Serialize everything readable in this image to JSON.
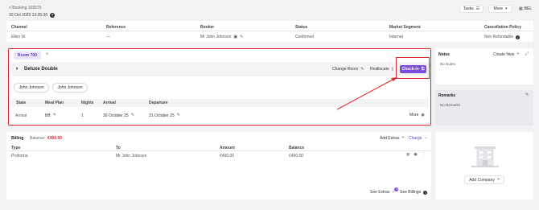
{
  "header": {
    "back_label": "< Booking 105575",
    "datetime": "30 Oct 2025 13:35:36",
    "tasks": "Tasks",
    "more": "More",
    "user": "BEL"
  },
  "booking_table": {
    "headers": [
      "Channel",
      "Reference",
      "Booker",
      "Status",
      "Market Segment",
      "Cancellation Policy"
    ],
    "row": [
      "Ellen W.",
      "—",
      "Mr John Johnson",
      "Confirmed",
      "Internet",
      "Non Refundable"
    ]
  },
  "room": {
    "tab_label": "Room 700",
    "add_tab": "+",
    "type": "Deluxe Double",
    "change_room": "Change Room",
    "reallocate": "Reallocate",
    "check_in": "Check-in",
    "guests": [
      "John Johnson",
      "John Johnson"
    ],
    "stay_headers": [
      "State",
      "Meal Plan",
      "Nights",
      "Arrival",
      "Departure"
    ],
    "stay_row": [
      "Arrival",
      "BB",
      "1",
      "30 October 25",
      "31 October 25"
    ],
    "more": "More"
  },
  "billing": {
    "title": "Billing",
    "balance_label": "Balance:",
    "balance_value": "€490.00",
    "add_extras": "Add Extras",
    "charge": "Charge",
    "headers": [
      "Type",
      "To",
      "Amount",
      "Balance"
    ],
    "row": [
      "Proforma",
      "Mr John Johnson",
      "€490.00",
      "€490.00"
    ],
    "see_extras": "See Extras",
    "extras_count": "0",
    "see_billings": "See Billings"
  },
  "notes": {
    "title": "Notes",
    "create_new": "Create New",
    "empty": "No Notes"
  },
  "remarks": {
    "title": "Remarks",
    "empty": "No Remarks"
  },
  "company": {
    "add_company": "Add Company"
  },
  "colors": {
    "accent": "#7c4ddb",
    "red": "#e0262b",
    "tab_bg": "#ebe6fb"
  }
}
